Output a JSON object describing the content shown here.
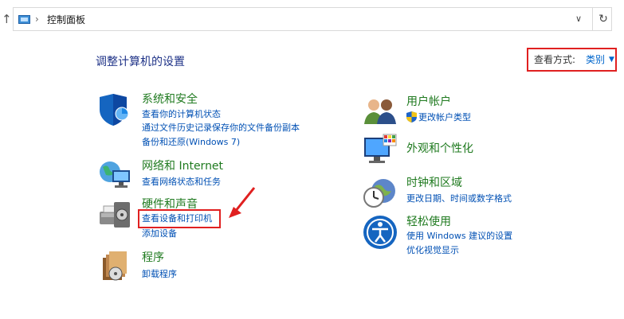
{
  "address_bar": {
    "path": "控制面板"
  },
  "page_title": "调整计算机的设置",
  "view_by": {
    "label": "查看方式:",
    "value": "类别"
  },
  "categories": [
    {
      "title": "系统和安全",
      "links": [
        "查看你的计算机状态",
        "通过文件历史记录保存你的文件备份副本",
        "备份和还原(Windows 7)"
      ]
    },
    {
      "title": "网络和 Internet",
      "links": [
        "查看网络状态和任务"
      ]
    },
    {
      "title": "硬件和声音",
      "links": [
        "查看设备和打印机",
        "添加设备"
      ]
    },
    {
      "title": "程序",
      "links": [
        "卸载程序"
      ]
    },
    {
      "title": "用户帐户",
      "links": [
        "更改帐户类型"
      ]
    },
    {
      "title": "外观和个性化",
      "links": []
    },
    {
      "title": "时钟和区域",
      "links": [
        "更改日期、时间或数字格式"
      ]
    },
    {
      "title": "轻松使用",
      "links": [
        "使用 Windows 建议的设置",
        "优化视觉显示"
      ]
    }
  ],
  "colors": {
    "category_title": "#1f7a1f",
    "link": "#0050b4",
    "page_title": "#1e3287",
    "annotation": "#e02020"
  },
  "icons": [
    "shield-icon",
    "network-icon",
    "printer-icon",
    "programs-icon",
    "users-icon",
    "appearance-icon",
    "clock-globe-icon",
    "ease-of-access-icon"
  ]
}
